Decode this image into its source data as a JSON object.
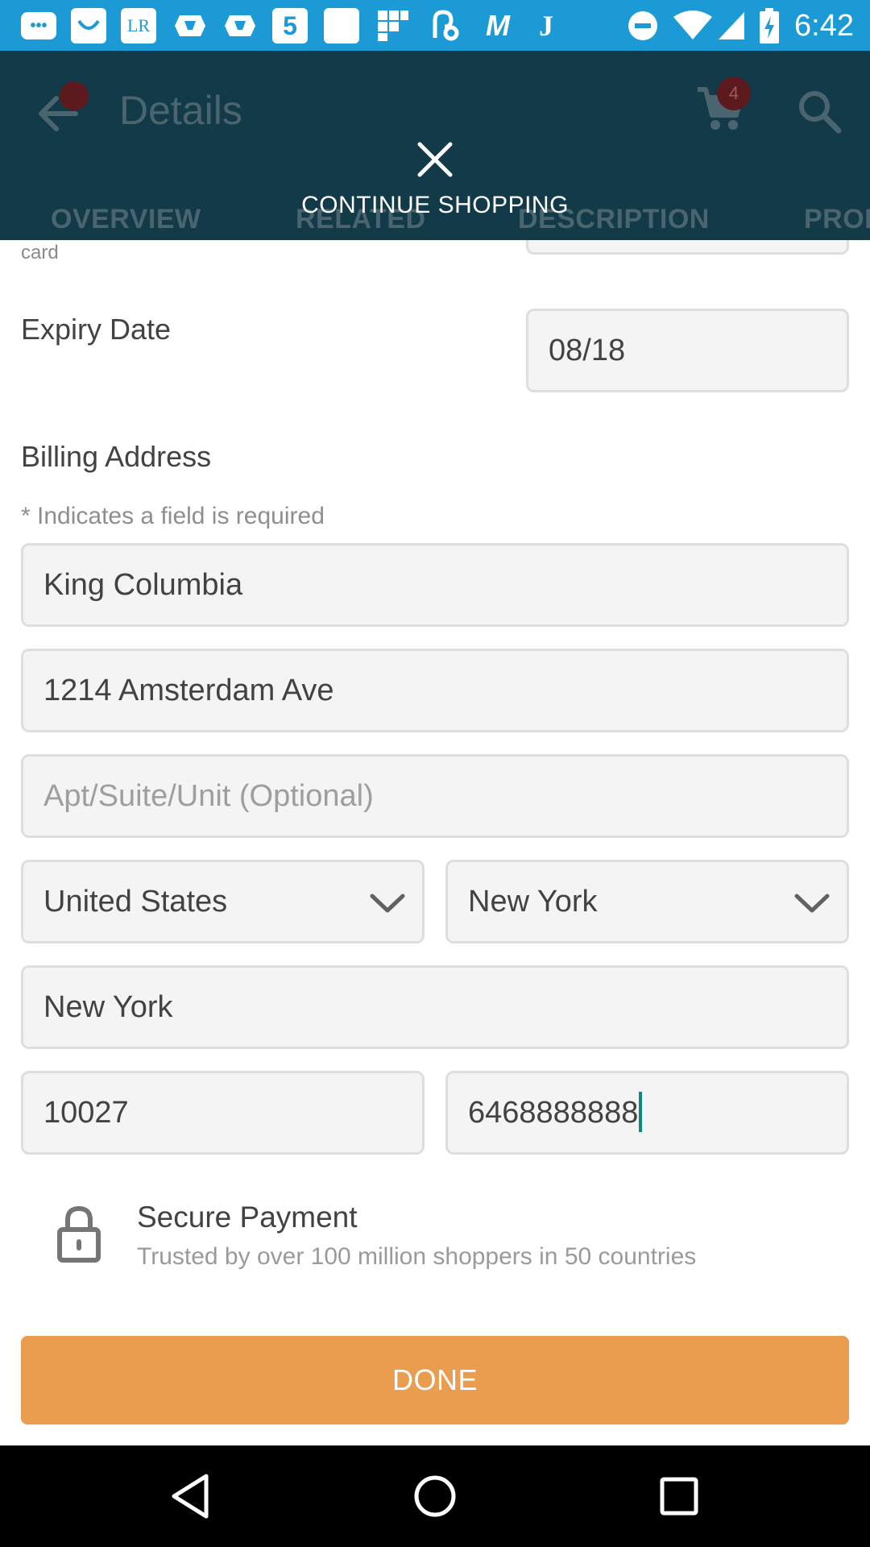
{
  "status_bar": {
    "time": "6:42",
    "icons": [
      "message-icon",
      "smile-app-icon",
      "lr-app-icon",
      "shop-bag-icon",
      "shop-bag-icon",
      "five-app-icon",
      "blank-app-icon",
      "grid-app-icon",
      "link-app-icon",
      "m-app-icon",
      "j-app-icon",
      "do-not-disturb-icon",
      "wifi-icon",
      "cell-signal-icon",
      "battery-charging-icon"
    ],
    "icon_labels": {
      "lr": "LR",
      "five": "5",
      "m": "M",
      "j": "J"
    }
  },
  "app_bar": {
    "title": "Details",
    "cart_count": "4",
    "tabs": [
      "OVERVIEW",
      "RELATED",
      "DESCRIPTION",
      "PROD"
    ],
    "overlay_action": "CONTINUE SHOPPING"
  },
  "form": {
    "card_fragment": "card",
    "expiry_label": "Expiry Date",
    "expiry_value": "08/18",
    "billing_title": "Billing Address",
    "required_hint": "* Indicates a field is required",
    "name_value": "King Columbia",
    "address_value": "1214 Amsterdam Ave",
    "apt_placeholder": "Apt/Suite/Unit (Optional)",
    "country_value": "United States",
    "state_value": "New York",
    "city_value": "New York",
    "zip_value": "10027",
    "phone_value": "6468888888"
  },
  "secure": {
    "title": "Secure Payment",
    "subtitle": "Trusted by over 100 million shoppers in 50 countries"
  },
  "done_label": "DONE",
  "colors": {
    "status_bar": "#1c9ad6",
    "app_bar": "#123a48",
    "done_button": "#eb9d4f",
    "field_bg": "#f4f4f4",
    "caret": "#0d8a7c"
  }
}
